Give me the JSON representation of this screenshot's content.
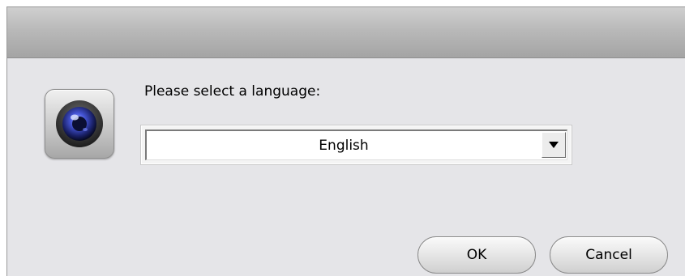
{
  "dialog": {
    "prompt": "Please select a language:",
    "language_select": {
      "value": "English"
    },
    "buttons": {
      "ok": "OK",
      "cancel": "Cancel"
    },
    "icon": "camera-lens-icon",
    "colors": {
      "background": "#e5e5e8",
      "titlebar": "#b9b9b9",
      "lens": "#1f2f8f"
    }
  }
}
